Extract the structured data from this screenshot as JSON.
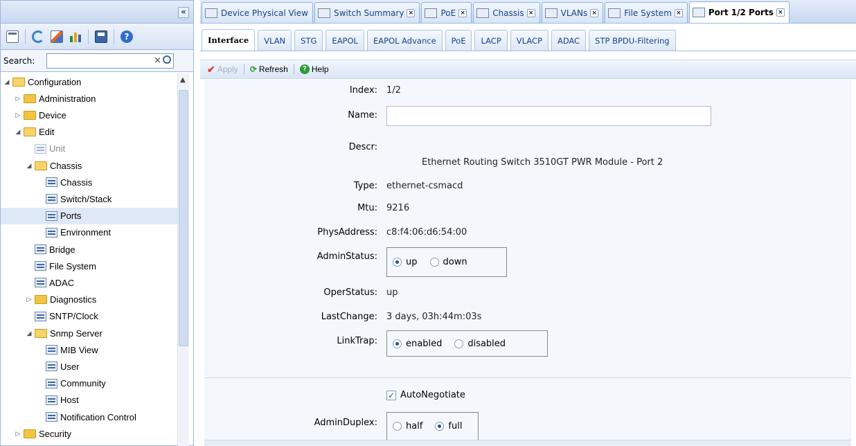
{
  "sidebar": {
    "search_label": "Search:",
    "tree": [
      {
        "label": "Configuration",
        "type": "folder-open",
        "expanded": true
      },
      {
        "label": "Administration",
        "type": "folder",
        "expanded": false
      },
      {
        "label": "Device",
        "type": "folder",
        "expanded": false
      },
      {
        "label": "Edit",
        "type": "folder-open",
        "expanded": true
      },
      {
        "label": "Unit",
        "type": "leaf-disabled"
      },
      {
        "label": "Chassis",
        "type": "folder-open",
        "expanded": true
      },
      {
        "label": "Chassis",
        "type": "leaf"
      },
      {
        "label": "Switch/Stack",
        "type": "leaf"
      },
      {
        "label": "Ports",
        "type": "leaf",
        "selected": true
      },
      {
        "label": "Environment",
        "type": "leaf"
      },
      {
        "label": "Bridge",
        "type": "leaf"
      },
      {
        "label": "File System",
        "type": "leaf"
      },
      {
        "label": "ADAC",
        "type": "leaf"
      },
      {
        "label": "Diagnostics",
        "type": "folder",
        "expanded": false
      },
      {
        "label": "SNTP/Clock",
        "type": "leaf"
      },
      {
        "label": "Snmp Server",
        "type": "folder-open",
        "expanded": true
      },
      {
        "label": "MIB View",
        "type": "leaf"
      },
      {
        "label": "User",
        "type": "leaf"
      },
      {
        "label": "Community",
        "type": "leaf"
      },
      {
        "label": "Host",
        "type": "leaf"
      },
      {
        "label": "Notification Control",
        "type": "leaf"
      },
      {
        "label": "Security",
        "type": "folder",
        "expanded": false
      }
    ]
  },
  "top_tabs": [
    {
      "label": "Device Physical View",
      "closable": false,
      "active": false
    },
    {
      "label": "Switch Summary",
      "closable": true,
      "active": false
    },
    {
      "label": "PoE",
      "closable": true,
      "active": false
    },
    {
      "label": "Chassis",
      "closable": true,
      "active": false
    },
    {
      "label": "VLANs",
      "closable": true,
      "active": false
    },
    {
      "label": "File System",
      "closable": true,
      "active": false
    },
    {
      "label": "Port 1/2 Ports",
      "closable": true,
      "active": true
    }
  ],
  "sub_tabs": [
    "Interface",
    "VLAN",
    "STG",
    "EAPOL",
    "EAPOL Advance",
    "PoE",
    "LACP",
    "VLACP",
    "ADAC",
    "STP BPDU-Filtering"
  ],
  "toolbar": {
    "apply": "Apply",
    "refresh": "Refresh",
    "help": "Help"
  },
  "form": {
    "index_label": "Index:",
    "index_value": "1/2",
    "name_label": "Name:",
    "name_value": "",
    "descr_label": "Descr:",
    "descr_value": "Ethernet Routing Switch 3510GT PWR Module - Port 2",
    "type_label": "Type:",
    "type_value": "ethernet-csmacd",
    "mtu_label": "Mtu:",
    "mtu_value": "9216",
    "phys_label": "PhysAddress:",
    "phys_value": "c8:f4:06:d6:54:00",
    "admin_label": "AdminStatus:",
    "admin_up": "up",
    "admin_down": "down",
    "oper_label": "OperStatus:",
    "oper_value": "up",
    "lastchange_label": "LastChange:",
    "lastchange_value": "3 days, 03h:44m:03s",
    "linktrap_label": "LinkTrap:",
    "linktrap_enabled": "enabled",
    "linktrap_disabled": "disabled",
    "autoneg_label": "AutoNegotiate",
    "duplex_label": "AdminDuplex:",
    "duplex_half": "half",
    "duplex_full": "full"
  },
  "colors": {
    "accent": "#15428b",
    "tab_border": "#99bbe8",
    "form_bg": "#f4f8fd"
  }
}
